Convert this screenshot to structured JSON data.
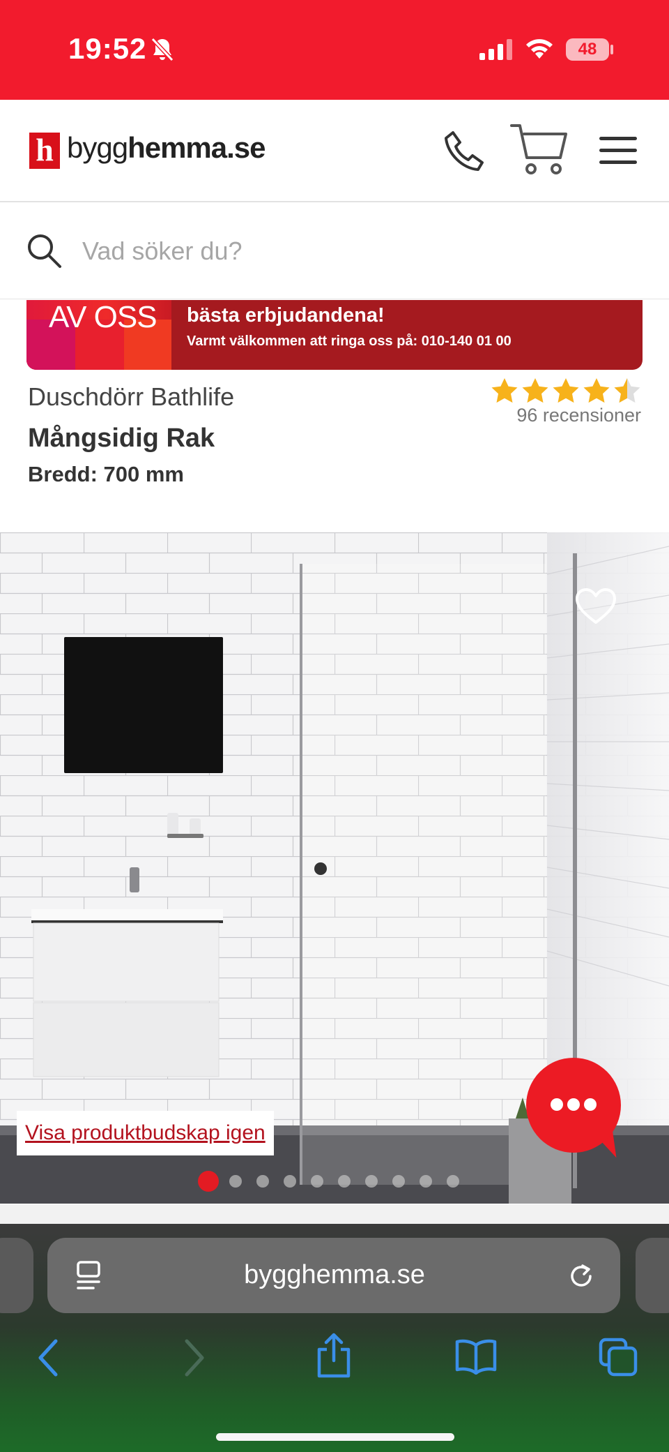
{
  "status_bar": {
    "time": "19:52",
    "battery": "48"
  },
  "header": {
    "logo_mark": "h",
    "logo_text_regular": "bygg",
    "logo_text_bold": "hemma.se"
  },
  "search": {
    "placeholder": "Vad söker du?"
  },
  "banner": {
    "left_text": "AV OSS",
    "line1": "bästa erbjudandena!",
    "line2": "Varmt välkommen att ringa oss på: 010-140 01 00"
  },
  "product": {
    "brand": "Duschdörr Bathlife",
    "model": "Mångsidig Rak",
    "width": "Bredd: 700 mm",
    "rating": 4.5,
    "reviews": "96 recensioner"
  },
  "gallery": {
    "view_message": "Visa produktbudskap igen",
    "current_index": 1,
    "total_images": 10
  },
  "browser": {
    "url": "bygghemma.se"
  },
  "colors": {
    "brand_red": "#f21b2d",
    "star": "#f7b21b",
    "link": "#b3121e"
  },
  "icons": [
    "bell-slash-icon",
    "signal-icon",
    "wifi-icon",
    "phone-icon",
    "cart-icon",
    "menu-icon",
    "search-icon",
    "heart-icon",
    "chat-icon",
    "reader-icon",
    "reload-icon",
    "back-icon",
    "forward-icon",
    "share-icon",
    "bookmarks-icon",
    "tabs-icon"
  ]
}
